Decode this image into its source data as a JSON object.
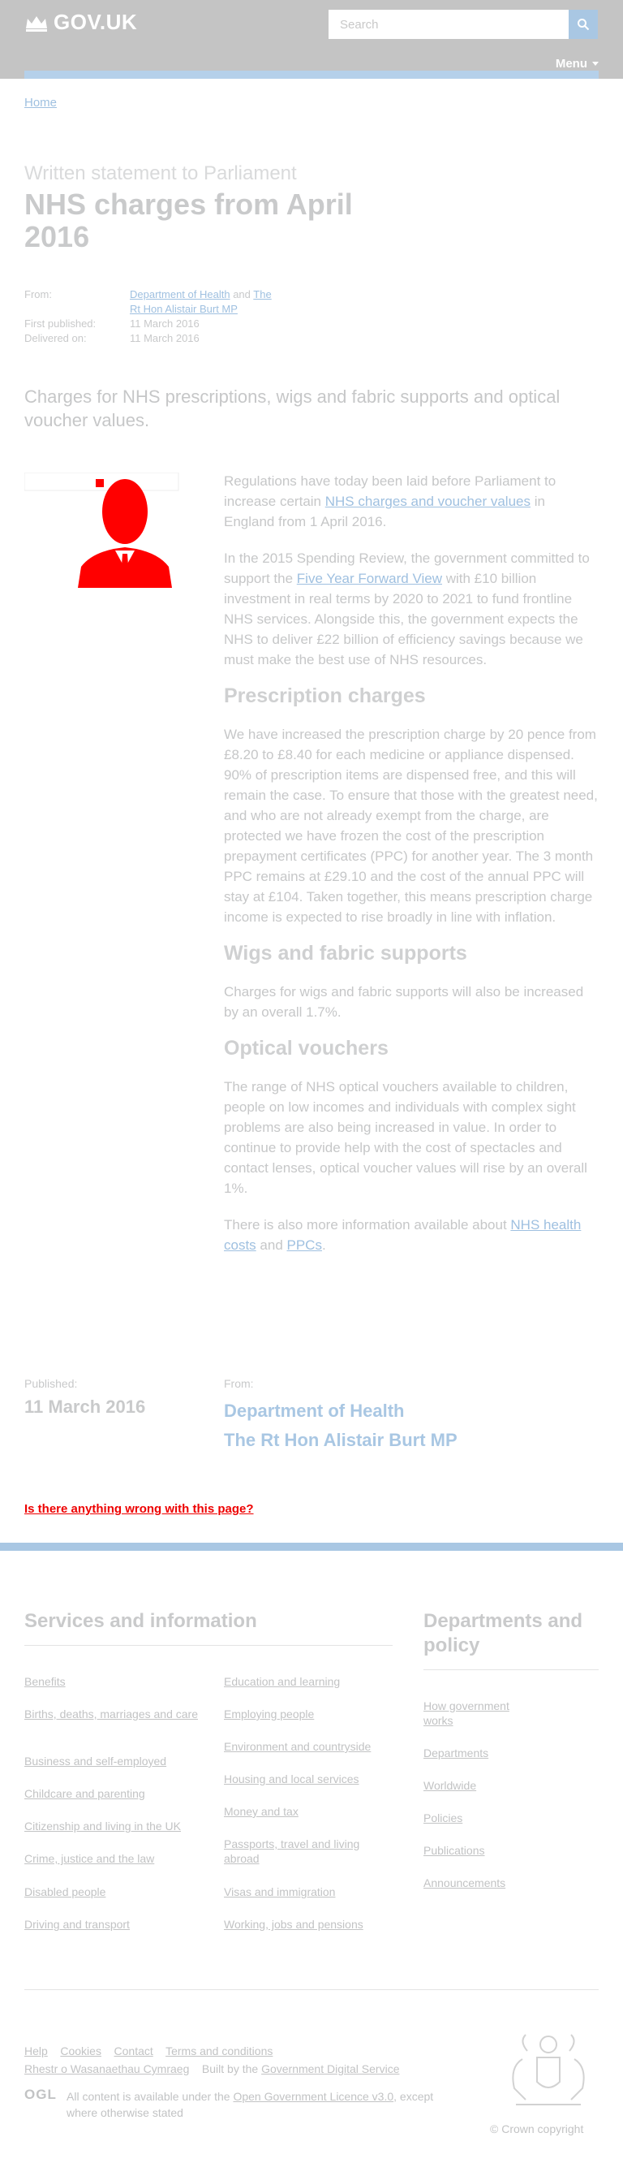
{
  "header": {
    "logo_text": "GOV.UK",
    "search_placeholder": "Search",
    "menu_label": "Menu"
  },
  "breadcrumb": {
    "home": "Home"
  },
  "title": {
    "context": "Written statement to Parliament",
    "heading": "NHS charges from April 2016"
  },
  "meta": {
    "from_label": "From:",
    "from_org1": "Department of Health",
    "from_and": "and",
    "from_org2": "The Rt Hon Alistair Burt MP",
    "first_published_label": "First published:",
    "first_published": "11 March 2016",
    "delivered_label": "Delivered on:",
    "delivered": "11 March 2016"
  },
  "lead": "Charges for NHS prescriptions, wigs and fabric supports and optical voucher values.",
  "body": {
    "p1_a": "Regulations have today been laid before Parliament to increase certain ",
    "p1_link": "NHS charges and voucher values",
    "p1_b": " in England from 1 April 2016.",
    "p2_a": "In the 2015 Spending Review, the government committed to support the ",
    "p2_link": "Five Year Forward View",
    "p2_b": " with £10 billion investment in real terms by 2020 to 2021 to fund frontline NHS services. Alongside this, the government expects the NHS to deliver £22 billion of efficiency savings because we must make the best use of NHS resources.",
    "h_prescription": "Prescription charges",
    "p3": "We have increased the prescription charge by 20 pence from £8.20 to £8.40 for each medicine or appliance dispensed. 90% of prescription items are dispensed free, and this will remain the case. To ensure that those with the greatest need, and who are not already exempt from the charge, are protected we have frozen the cost of the prescription prepayment certificates (PPC) for another year. The 3 month PPC remains at £29.10 and the cost of the annual PPC will stay at £104. Taken together, this means prescription charge income is expected to rise broadly in line with inflation.",
    "h_wigs": "Wigs and fabric supports",
    "p4": "Charges for wigs and fabric supports will also be increased by an overall 1.7%.",
    "h_optical": "Optical vouchers",
    "p5": "The range of NHS optical vouchers available to children, people on low incomes and individuals with complex sight problems are also being increased in value. In order to continue to provide help with the cost of spectacles and contact lenses, optical voucher values will rise by an overall 1%.",
    "p6_a": "There is also more information available about ",
    "p6_link1": "NHS health costs",
    "p6_and": " and ",
    "p6_link2": "PPCs",
    "p6_end": "."
  },
  "published": {
    "label": "Published:",
    "date": "11 March 2016",
    "from_label": "From:",
    "org1": "Department of Health",
    "org2": "The Rt Hon Alistair Burt MP"
  },
  "report_link": "Is there anything wrong with this page?",
  "footer": {
    "services_heading": "Services and information",
    "departments_heading": "Departments and policy",
    "col1": [
      "Benefits",
      "Births, deaths, marriages and care",
      "Business and self-employed",
      "Childcare and parenting",
      "Citizenship and living in the UK",
      "Crime, justice and the law",
      "Disabled people",
      "Driving and transport"
    ],
    "col2": [
      "Education and learning",
      "Employing people",
      "Environment and countryside",
      "Housing and local services",
      "Money and tax",
      "Passports, travel and living abroad",
      "Visas and immigration",
      "Working, jobs and pensions"
    ],
    "col3": [
      "How government works",
      "Departments",
      "Worldwide",
      "Policies",
      "Publications",
      "Announcements"
    ],
    "legal_links": [
      "Help",
      "Cookies",
      "Contact",
      "Terms and conditions"
    ],
    "welsh": "Rhestr o Wasanaethau Cymraeg",
    "built_by_prefix": "Built by the ",
    "built_by_link": "Government Digital Service",
    "ogl": "OGL",
    "licence_a": "All content is available under the ",
    "licence_link": "Open Government Licence v3.0",
    "licence_b": ", except where otherwise stated",
    "copyright": "© Crown copyright"
  },
  "colors": {
    "header_bg": "#c4c4c4",
    "accent": "#a9c7e3",
    "link": "#9fc0e0",
    "portrait": "#ff0000"
  }
}
